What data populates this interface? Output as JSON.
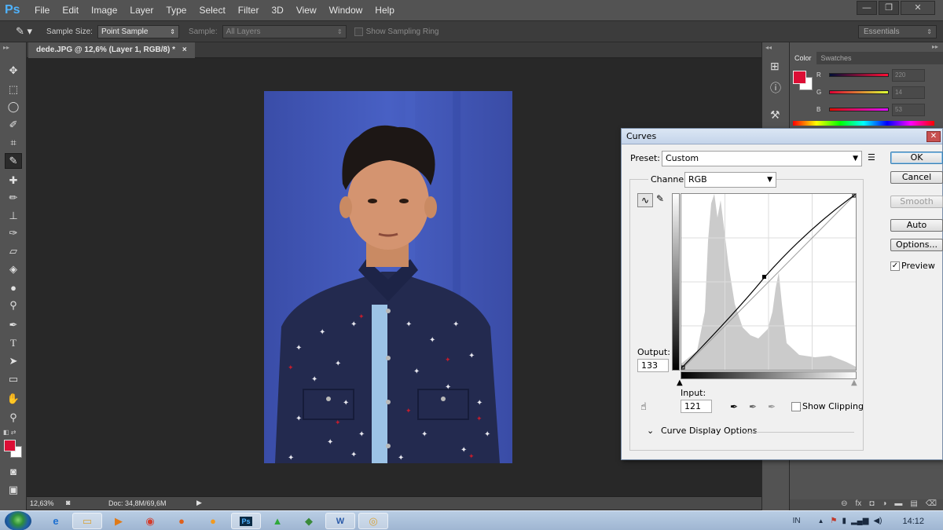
{
  "app": {
    "logo": "Ps",
    "menu": [
      "File",
      "Edit",
      "Image",
      "Layer",
      "Type",
      "Select",
      "Filter",
      "3D",
      "View",
      "Window",
      "Help"
    ],
    "window_buttons": [
      "—",
      "❐",
      "✕"
    ]
  },
  "options_bar": {
    "sample_size_label": "Sample Size:",
    "sample_size_value": "Point Sample",
    "sample_label": "Sample:",
    "sample_value": "All Layers",
    "show_ring_label": "Show Sampling Ring",
    "workspace": "Essentials"
  },
  "document": {
    "tab_title": "dede.JPG @ 12,6% (Layer 1, RGB/8) *",
    "tab_close": "×",
    "zoom": "12,63%",
    "doc_info": "Doc: 34,8M/69,6M"
  },
  "color_panel": {
    "tabs": [
      "Color",
      "Swatches"
    ],
    "channels": [
      {
        "label": "R",
        "value": "220"
      },
      {
        "label": "G",
        "value": "14"
      },
      {
        "label": "B",
        "value": "53"
      }
    ],
    "foreground": "#dc0e35",
    "background": "#ffffff"
  },
  "curves": {
    "title": "Curves",
    "close": "✕",
    "preset_label": "Preset:",
    "preset_value": "Custom",
    "channel_label": "Channel:",
    "channel_value": "RGB",
    "buttons": {
      "ok": "OK",
      "cancel": "Cancel",
      "smooth": "Smooth",
      "auto": "Auto",
      "options": "Options..."
    },
    "preview_label": "Preview",
    "output_label": "Output:",
    "output_value": "133",
    "input_label": "Input:",
    "input_value": "121",
    "show_clipping_label": "Show Clipping",
    "display_options_label": "Curve Display Options"
  },
  "taskbar": {
    "lang": "IN",
    "time": "14:12"
  }
}
